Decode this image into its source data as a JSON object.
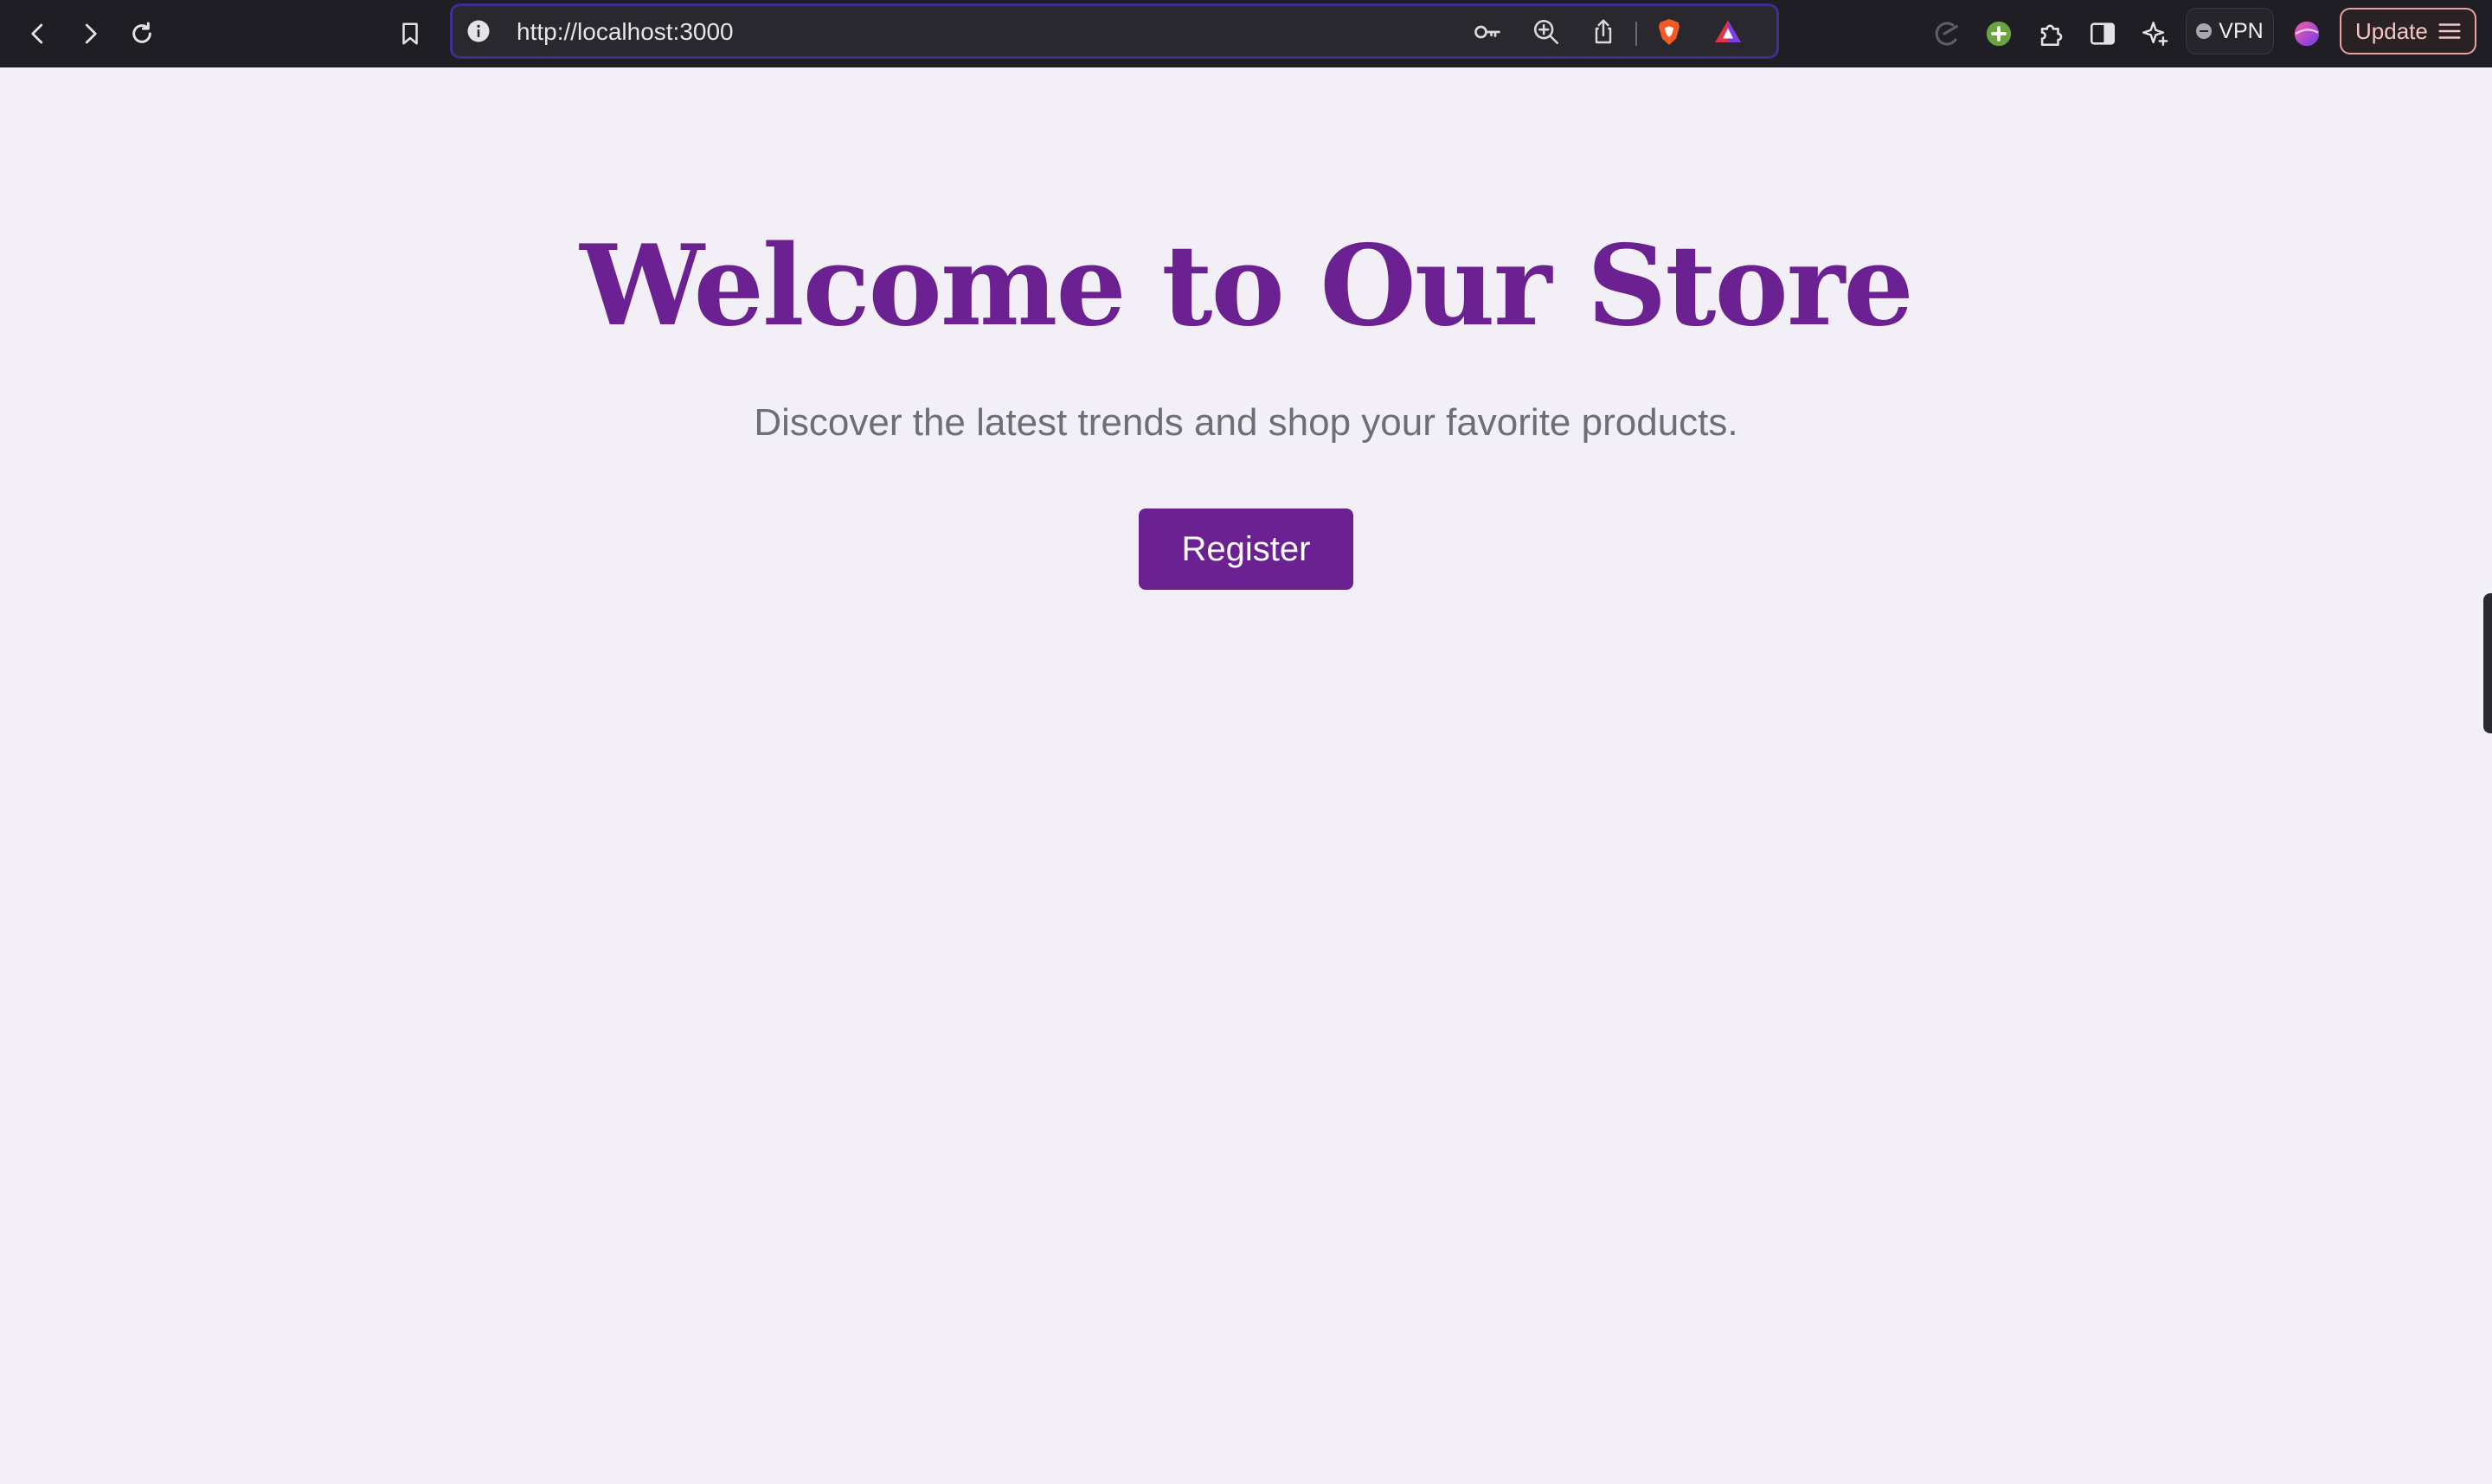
{
  "browser": {
    "url": "http://localhost:3000",
    "vpn_label": "VPN",
    "update_label": "Update",
    "icons": {
      "back": "chevron-left-icon",
      "forward": "chevron-right-icon",
      "reload": "reload-icon",
      "bookmark": "bookmark-icon",
      "site_info": "info-icon",
      "password": "key-icon",
      "zoom": "zoom-in-icon",
      "share": "share-icon",
      "brave_shields": "brave-shield-icon",
      "brave_rewards": "rewards-triangle-icon",
      "leo": "leo-icon",
      "extension_plus": "plus-circle-icon",
      "extensions": "puzzle-icon",
      "sidebar": "sidebar-icon",
      "ai": "sparkle-icon",
      "profile": "profile-avatar-icon",
      "menu": "hamburger-menu-icon"
    },
    "colors": {
      "toolbar_bg": "#1f1e24",
      "url_border": "#3b2f8f",
      "update_border": "#e9a1a1"
    }
  },
  "hero": {
    "title": "Welcome to Our Store",
    "subtitle": "Discover the latest trends and shop your favorite products.",
    "register_label": "Register"
  },
  "colors": {
    "page_bg": "#f2eff7",
    "accent": "#6b2191",
    "subtitle_text": "#6e6e78"
  }
}
